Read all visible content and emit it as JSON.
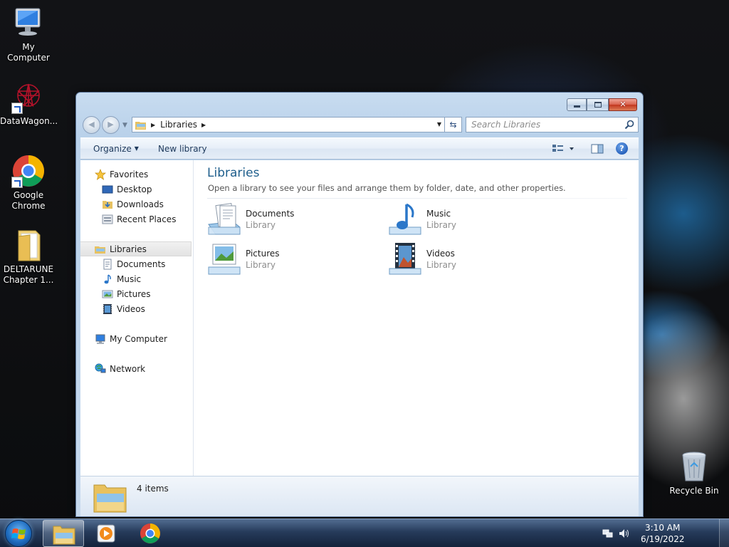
{
  "desktop": {
    "icons": [
      {
        "label": "My Computer"
      },
      {
        "label": "DataWagon..."
      },
      {
        "label": "Google Chrome"
      },
      {
        "label": "DELTARUNE Chapter 1..."
      },
      {
        "label": "Recycle Bin"
      }
    ]
  },
  "window": {
    "address": {
      "crumb": "Libraries"
    },
    "search": {
      "placeholder": "Search Libraries"
    },
    "toolbar": {
      "organize_label": "Organize",
      "new_library_label": "New library"
    },
    "nav_pane": {
      "favorites": "Favorites",
      "favorites_items": [
        "Desktop",
        "Downloads",
        "Recent Places"
      ],
      "libraries": "Libraries",
      "libraries_items": [
        "Documents",
        "Music",
        "Pictures",
        "Videos"
      ],
      "computer": "My Computer",
      "network": "Network"
    },
    "content": {
      "title": "Libraries",
      "subtitle": "Open a library to see your files and arrange them by folder, date, and other properties.",
      "tiles": [
        {
          "name": "Documents",
          "type": "Library",
          "icon": "documents-library-icon"
        },
        {
          "name": "Music",
          "type": "Library",
          "icon": "music-library-icon"
        },
        {
          "name": "Pictures",
          "type": "Library",
          "icon": "pictures-library-icon"
        },
        {
          "name": "Videos",
          "type": "Library",
          "icon": "videos-library-icon"
        }
      ]
    },
    "details": {
      "count": "4 items"
    }
  },
  "taskbar": {
    "clock": {
      "time": "3:10 AM",
      "date": "6/19/2022"
    }
  },
  "colors": {
    "content_title": "#1e5e8c",
    "accent_blue": "#1e5bc6"
  }
}
